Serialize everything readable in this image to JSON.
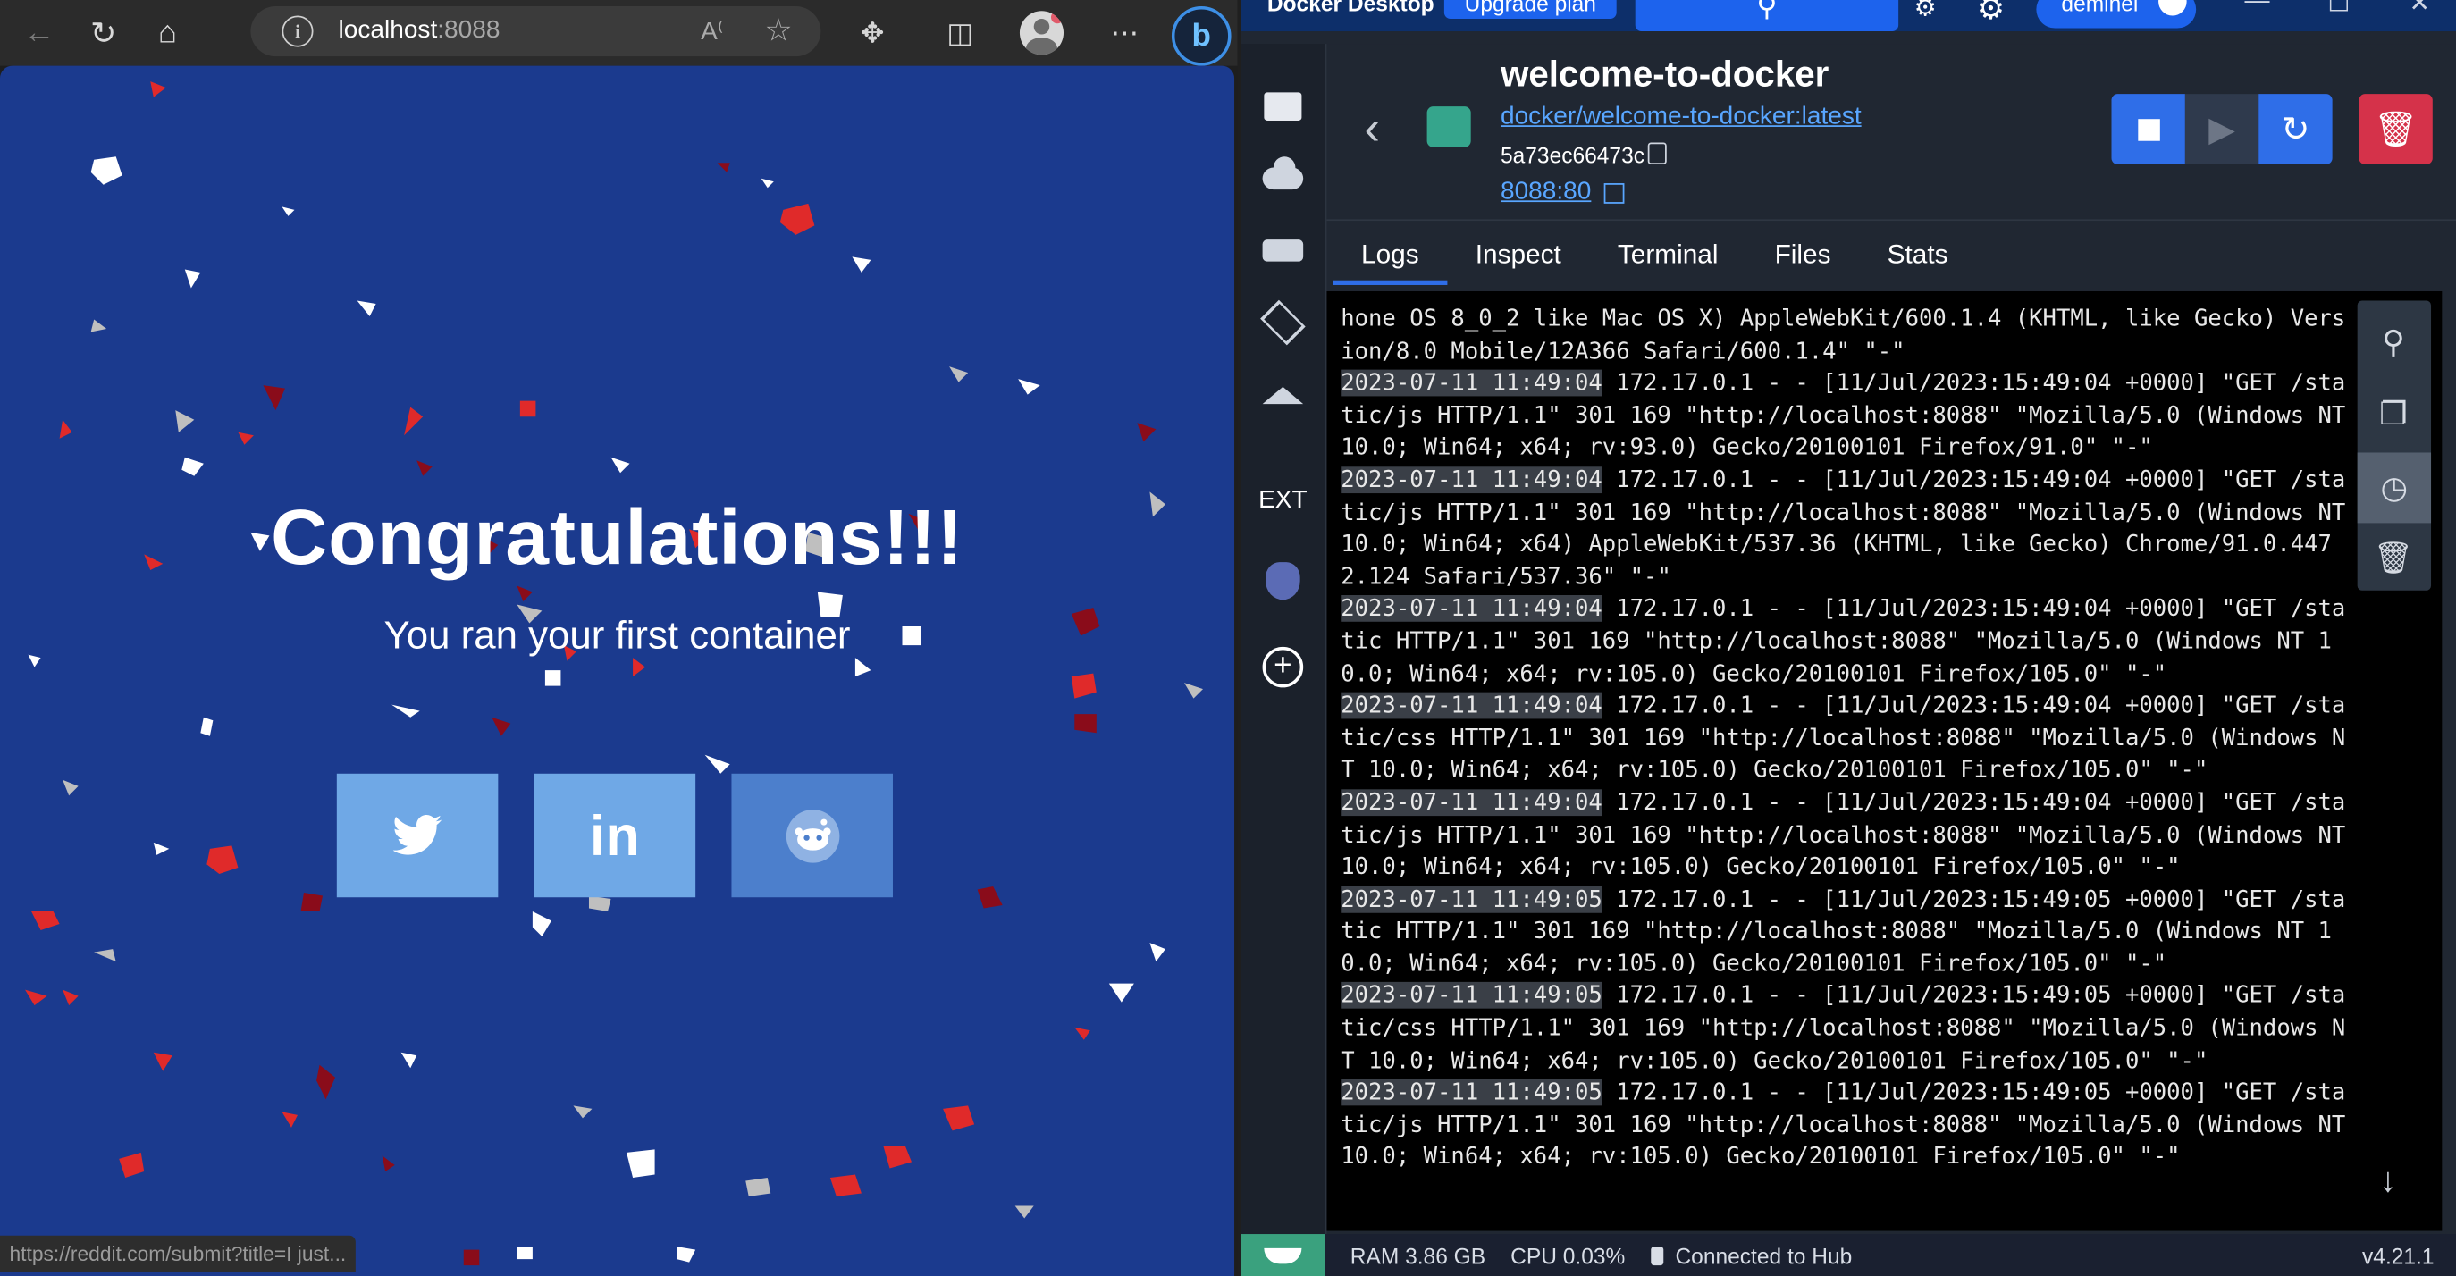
{
  "browser": {
    "url_host": "localhost",
    "url_port": ":8088",
    "status_url": "https://reddit.com/submit?title=I just..."
  },
  "page": {
    "heading": "Congratulations!!!",
    "subtitle": "You ran your first container",
    "share_buttons": [
      {
        "name": "twitter",
        "icon": "twitter-bird-icon"
      },
      {
        "name": "linkedin",
        "label": "in",
        "icon": "linkedin-icon"
      },
      {
        "name": "reddit",
        "icon": "reddit-icon"
      }
    ],
    "colors": {
      "background": "#1b3a8e",
      "confetti": [
        "#e02a2a",
        "#8a0c1a",
        "#ffffff",
        "#bfbfbf"
      ]
    }
  },
  "docker": {
    "title_bar": {
      "app_name": "Docker Desktop",
      "upgrade_label": "Upgrade plan",
      "user_label": "deminel"
    },
    "sidebar": {
      "ext_label": "EXT"
    },
    "container": {
      "name": "welcome-to-docker",
      "image": "docker/welcome-to-docker:latest",
      "id": "5a73ec66473c",
      "port": "8088:80"
    },
    "tabs": [
      "Logs",
      "Inspect",
      "Terminal",
      "Files",
      "Stats"
    ],
    "logs": [
      {
        "ts": "",
        "text": "hone OS 8_0_2 like Mac OS X) AppleWebKit/600.1.4 (KHTML, like Gecko) Version/8.0 Mobile/12A366 Safari/600.1.4\" \"-\""
      },
      {
        "ts": "2023-07-11 11:49:04",
        "text": " 172.17.0.1 - - [11/Jul/2023:15:49:04 +0000] \"GET /static/js HTTP/1.1\" 301 169 \"http://localhost:8088\" \"Mozilla/5.0 (Windows NT 10.0; Win64; x64; rv:93.0) Gecko/20100101 Firefox/91.0\" \"-\""
      },
      {
        "ts": "2023-07-11 11:49:04",
        "text": " 172.17.0.1 - - [11/Jul/2023:15:49:04 +0000] \"GET /static/js HTTP/1.1\" 301 169 \"http://localhost:8088\" \"Mozilla/5.0 (Windows NT 10.0; Win64; x64) AppleWebKit/537.36 (KHTML, like Gecko) Chrome/91.0.4472.124 Safari/537.36\" \"-\""
      },
      {
        "ts": "2023-07-11 11:49:04",
        "text": " 172.17.0.1 - - [11/Jul/2023:15:49:04 +0000] \"GET /static HTTP/1.1\" 301 169 \"http://localhost:8088\" \"Mozilla/5.0 (Windows NT 10.0; Win64; x64; rv:105.0) Gecko/20100101 Firefox/105.0\" \"-\""
      },
      {
        "ts": "2023-07-11 11:49:04",
        "text": " 172.17.0.1 - - [11/Jul/2023:15:49:04 +0000] \"GET /static/css HTTP/1.1\" 301 169 \"http://localhost:8088\" \"Mozilla/5.0 (Windows NT 10.0; Win64; x64; rv:105.0) Gecko/20100101 Firefox/105.0\" \"-\""
      },
      {
        "ts": "2023-07-11 11:49:04",
        "text": " 172.17.0.1 - - [11/Jul/2023:15:49:04 +0000] \"GET /static/js HTTP/1.1\" 301 169 \"http://localhost:8088\" \"Mozilla/5.0 (Windows NT 10.0; Win64; x64; rv:105.0) Gecko/20100101 Firefox/105.0\" \"-\""
      },
      {
        "ts": "2023-07-11 11:49:05",
        "text": " 172.17.0.1 - - [11/Jul/2023:15:49:05 +0000] \"GET /static HTTP/1.1\" 301 169 \"http://localhost:8088\" \"Mozilla/5.0 (Windows NT 10.0; Win64; x64; rv:105.0) Gecko/20100101 Firefox/105.0\" \"-\""
      },
      {
        "ts": "2023-07-11 11:49:05",
        "text": " 172.17.0.1 - - [11/Jul/2023:15:49:05 +0000] \"GET /static/css HTTP/1.1\" 301 169 \"http://localhost:8088\" \"Mozilla/5.0 (Windows NT 10.0; Win64; x64; rv:105.0) Gecko/20100101 Firefox/105.0\" \"-\""
      },
      {
        "ts": "2023-07-11 11:49:05",
        "text": " 172.17.0.1 - - [11/Jul/2023:15:49:05 +0000] \"GET /static/js HTTP/1.1\" 301 169 \"http://localhost:8088\" \"Mozilla/5.0 (Windows NT 10.0; Win64; x64; rv:105.0) Gecko/20100101 Firefox/105.0\" \"-\""
      }
    ],
    "footer": {
      "ram": "RAM 3.86 GB",
      "cpu": "CPU 0.03%",
      "hub": "Connected to Hub",
      "version": "v4.21.1"
    }
  }
}
